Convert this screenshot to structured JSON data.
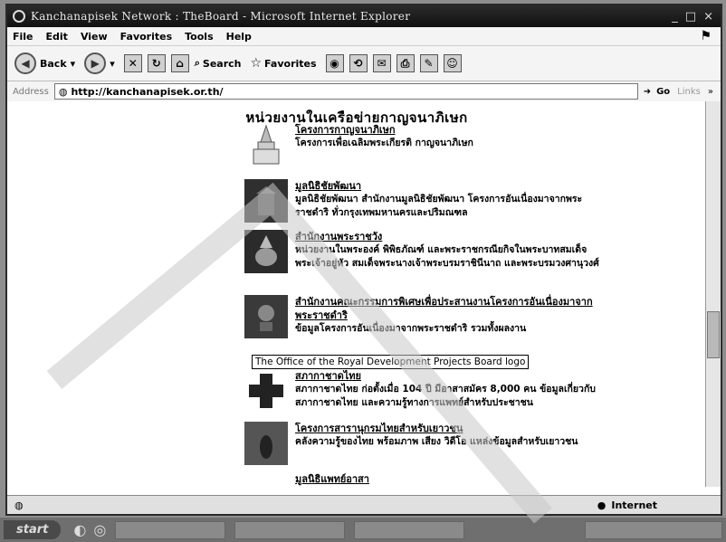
{
  "window": {
    "title": "Kanchanapisek Network : TheBoard - Microsoft Internet Explorer"
  },
  "menu": [
    "File",
    "Edit",
    "View",
    "Favorites",
    "Tools",
    "Help"
  ],
  "toolbar": {
    "back_label": "Back",
    "search_label": "Search",
    "favorites_label": "Favorites"
  },
  "address": {
    "label": "Address",
    "url": "http://kanchanapisek.or.th/",
    "go_label": "Go",
    "links_label": "Links"
  },
  "page": {
    "heading": "หน่วยงานในเครือข่ายกาญจนาภิเษก",
    "items": [
      {
        "title": "โครงการกาญจนาภิเษก",
        "desc": "โครงการเพื่อเฉลิมพระเกียรติ กาญจนาภิเษก",
        "icon": "pagoda-icon"
      },
      {
        "title": "มูลนิธิชัยพัฒนา",
        "desc": "มูลนิธิชัยพัฒนา สำนักงานมูลนิธิชัยพัฒนา โครงการอันเนื่องมาจากพระราชดำริ ทั่วกรุงเทพมหานครและปริมณฑล",
        "icon": "building-icon"
      },
      {
        "title": "สำนักงานพระราชวัง",
        "desc": "หน่วยงานในพระองค์ พิพิธภัณฑ์ และพระราชกรณียกิจในพระบาทสมเด็จพระเจ้าอยู่หัว สมเด็จพระนางเจ้าพระบรมราชินีนาถ และพระบรมวงศานุวงศ์",
        "icon": "crest-icon"
      },
      {
        "title": "สำนักงานคณะกรรมการพิเศษเพื่อประสานงานโครงการอันเนื่องมาจากพระราชดำริ",
        "desc": "ข้อมูลโครงการอันเนื่องมาจากพระราชดำริ รวมทั้งผลงาน",
        "icon": "emblem-icon"
      },
      {
        "title": "สภากาชาดไทย",
        "desc": "สภากาชาดไทย ก่อตั้งเมื่อ 104 ปี มีอาสาสมัคร 8,000 คน ข้อมูลเกี่ยวกับสภากาชาดไทย และความรู้ทางการแพทย์สำหรับประชาชน",
        "icon": "red-cross-icon"
      },
      {
        "title": "โครงการสารานุกรมไทยสำหรับเยาวชน",
        "desc": "คลังความรู้ของไทย พร้อมภาพ เสียง วิดีโอ แหล่งข้อมูลสำหรับเยาวชน",
        "icon": "book-icon"
      },
      {
        "title": "มูลนิธิแพทย์อาสา",
        "desc": "",
        "icon": "seal-icon"
      }
    ],
    "tooltip": "The Office of the Royal Development Projects Board logo"
  },
  "status": {
    "zone_label": "Internet"
  },
  "taskbar": {
    "start_label": "start"
  }
}
